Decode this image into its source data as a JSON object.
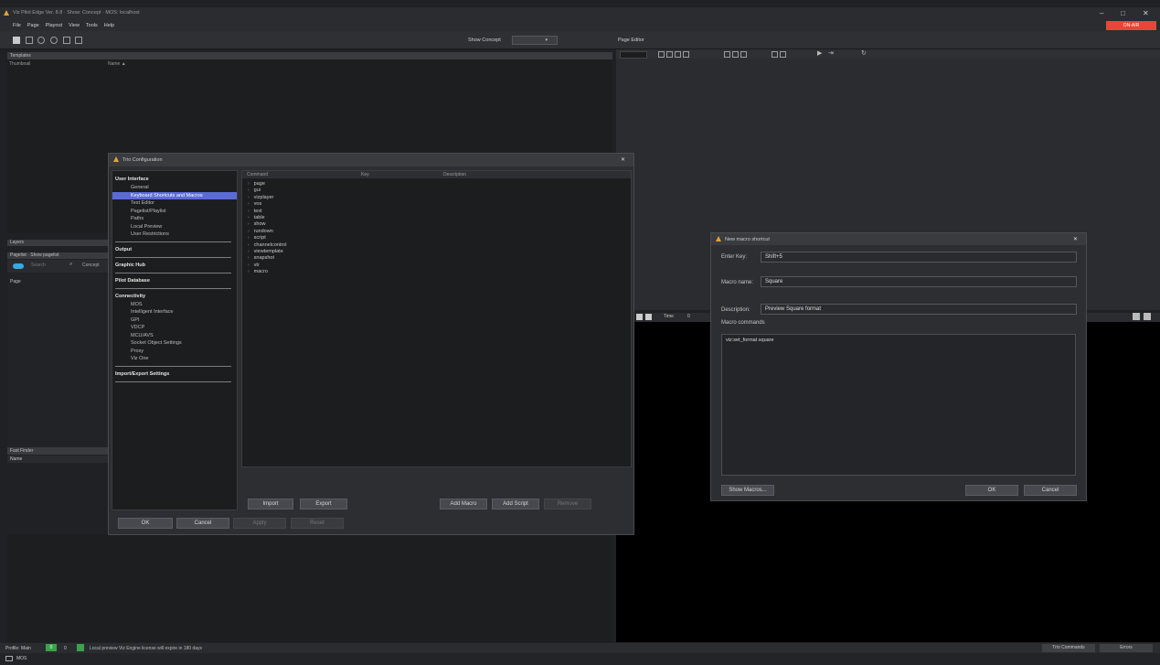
{
  "window": {
    "title": "Viz Pilot Edge Ver. 8.8 · Show: Concept · MOS: localhost",
    "controls": {
      "minimize": "–",
      "maximize": "□",
      "close": "✕"
    },
    "online_badge": "ON-AIR"
  },
  "menu": [
    "File",
    "Page",
    "Playout",
    "View",
    "Tools",
    "Help"
  ],
  "toolbar": {
    "show_concept_label": "Show Concept",
    "show_concept_value": "▾",
    "page_editor_label": "Page Editor"
  },
  "left_panel": {
    "templates_header": "Templates",
    "columns": [
      "Thumbnail",
      "Name ▲"
    ],
    "layers_header": "Layers",
    "pagelist_header": "Pagelist · Show pagelist",
    "search_placeholder": "Search",
    "concept_label": "Concept",
    "page_col": "Page",
    "fast_finder_header": "Fast Finder",
    "name_col": "Name"
  },
  "right_panel": {
    "time_label": "Time",
    "time_value": "0"
  },
  "trio_config": {
    "title": "Trio Configuration",
    "nav": [
      {
        "type": "group",
        "label": "User Interface"
      },
      {
        "type": "item",
        "label": "General"
      },
      {
        "type": "item",
        "label": "Keyboard Shortcuts and Macros",
        "selected": true
      },
      {
        "type": "item",
        "label": "Text Editor"
      },
      {
        "type": "item",
        "label": "Pagelist/Playlist"
      },
      {
        "type": "item",
        "label": "Paths"
      },
      {
        "type": "item",
        "label": "Local Preview"
      },
      {
        "type": "item",
        "label": "User Restrictions"
      },
      {
        "type": "sep"
      },
      {
        "type": "group",
        "label": "Output"
      },
      {
        "type": "sep"
      },
      {
        "type": "group",
        "label": "Graphic Hub"
      },
      {
        "type": "sep"
      },
      {
        "type": "group",
        "label": "Pilot Database"
      },
      {
        "type": "sep"
      },
      {
        "type": "group",
        "label": "Connectivity"
      },
      {
        "type": "item",
        "label": "MOS"
      },
      {
        "type": "item",
        "label": "Intelligent Interface"
      },
      {
        "type": "item",
        "label": "GPI"
      },
      {
        "type": "item",
        "label": "VDCP"
      },
      {
        "type": "item",
        "label": "MCU/AVS"
      },
      {
        "type": "item",
        "label": "Socket Object Settings"
      },
      {
        "type": "item",
        "label": "Proxy"
      },
      {
        "type": "item",
        "label": "Viz One"
      },
      {
        "type": "sep"
      },
      {
        "type": "group",
        "label": "Import/Export Settings"
      },
      {
        "type": "sep"
      }
    ],
    "table_columns": [
      "Command",
      "Key",
      "Description"
    ],
    "commands": [
      "page",
      "gui",
      "vizplayer",
      "vos",
      "text",
      "table",
      "show",
      "rundown",
      "script",
      "channelcontrol",
      "viewtemplate",
      "snapshot",
      "vtr",
      "macro"
    ],
    "buttons": {
      "import": "Import",
      "export": "Export",
      "add_macro": "Add Macro",
      "add_script": "Add Script",
      "remove": "Remove",
      "ok": "OK",
      "cancel": "Cancel",
      "apply": "Apply",
      "reset": "Reset"
    }
  },
  "macro_dialog": {
    "title": "New macro shortcut",
    "enter_key_label": "Enter Key:",
    "enter_key_value": "Shift+5",
    "macro_name_label": "Macro name:",
    "macro_name_value": "Square",
    "description_label": "Description:",
    "description_value": "Preview Square format",
    "commands_label": "Macro commands",
    "commands_value": "viz:set_format square",
    "show_macros_button": "Show Macros...",
    "ok_button": "OK",
    "cancel_button": "Cancel"
  },
  "status_bar": {
    "profile_label": "Profile: Main",
    "count_a": "0",
    "count_b": "0",
    "message": "Local preview Viz Engine license will expire in 180 days",
    "trio_commands_button": "Trio Commands",
    "errors_button": "Errors",
    "mos_label": "MOS"
  },
  "colors": {
    "accent": "#5b6bd6",
    "online_red": "#e8453c",
    "warning": "#e0a33a",
    "status_green": "#3aa24b"
  }
}
